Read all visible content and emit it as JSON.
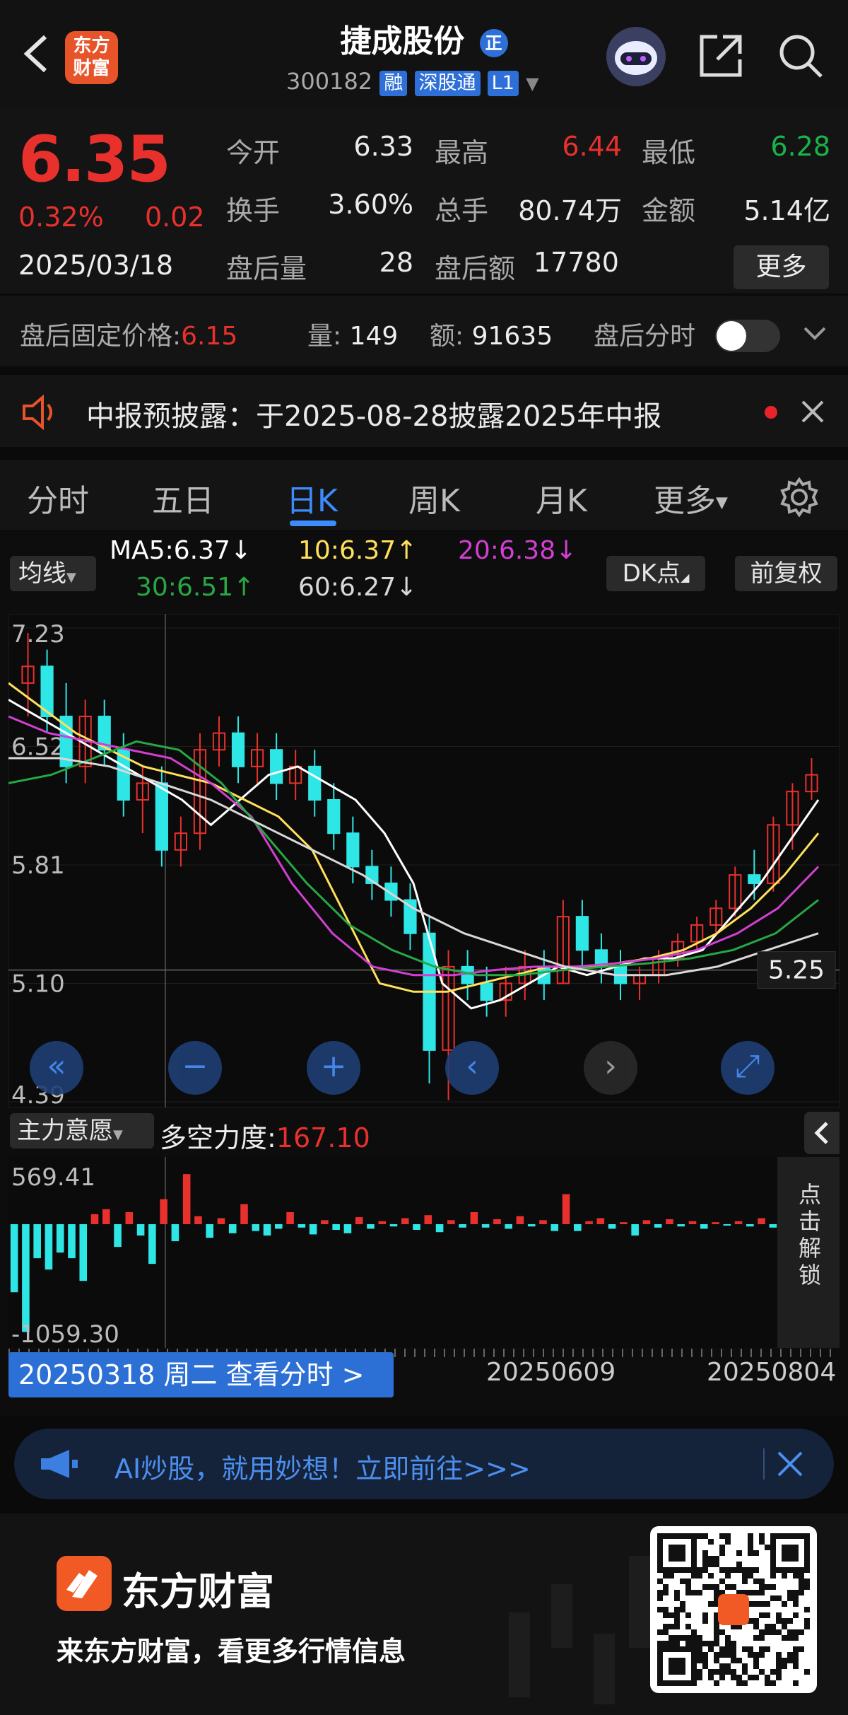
{
  "header": {
    "stock_name": "捷成股份",
    "badge": "正",
    "code": "300182",
    "tags": [
      "融",
      "深股通",
      "L1"
    ],
    "logo_line1": "东方",
    "logo_line2": "财富"
  },
  "quote": {
    "price": "6.35",
    "change_pct": "0.32%",
    "change": "0.02",
    "date": "2025/03/18",
    "open_label": "今开",
    "open": "6.33",
    "high_label": "最高",
    "high": "6.44",
    "low_label": "最低",
    "low": "6.28",
    "turnover_label": "换手",
    "turnover": "3.60%",
    "volume_label": "总手",
    "volume": "80.74万",
    "amount_label": "金额",
    "amount": "5.14亿",
    "after_vol_label": "盘后量",
    "after_vol": "28",
    "after_amt_label": "盘后额",
    "after_amt": "17780",
    "more": "更多"
  },
  "after_hours": {
    "fixed_label": "盘后固定价格:",
    "fixed_value": "6.15",
    "vol_label": "量:",
    "vol_value": "149",
    "amt_label": "额:",
    "amt_value": "91635",
    "timeshare_label": "盘后分时"
  },
  "notice": {
    "text": "中报预披露：于2025-08-28披露2025年中报"
  },
  "tabs": [
    "分时",
    "五日",
    "日K",
    "周K",
    "月K",
    "更多"
  ],
  "active_tab": "日K",
  "ma_bar": {
    "selector": "均线",
    "ma5": "MA5:6.37↓",
    "ma10": "10:6.37↑",
    "ma20": "20:6.38↓",
    "ma30": "30:6.51↑",
    "ma60": "60:6.27↓",
    "dk": "DK点",
    "adjust": "前复权"
  },
  "chart_data": {
    "type": "candlestick",
    "y_ticks": [
      "7.23",
      "6.52",
      "5.81",
      "5.10",
      "4.39"
    ],
    "ylim": [
      4.39,
      7.23
    ],
    "last_price_label": "5.25",
    "x_labels": [
      "20250318 周二 查看分时 >",
      "20250609",
      "20250804"
    ],
    "candles": [
      [
        6.9,
        7.2,
        6.7,
        7.0
      ],
      [
        7.0,
        7.1,
        6.6,
        6.7
      ],
      [
        6.7,
        6.9,
        6.3,
        6.4
      ],
      [
        6.4,
        6.8,
        6.3,
        6.7
      ],
      [
        6.7,
        6.8,
        6.4,
        6.5
      ],
      [
        6.5,
        6.6,
        6.1,
        6.2
      ],
      [
        6.2,
        6.4,
        6.0,
        6.3
      ],
      [
        6.3,
        6.4,
        5.8,
        5.9
      ],
      [
        5.9,
        6.1,
        5.8,
        6.0
      ],
      [
        6.0,
        6.6,
        5.9,
        6.5
      ],
      [
        6.5,
        6.7,
        6.4,
        6.6
      ],
      [
        6.6,
        6.7,
        6.3,
        6.4
      ],
      [
        6.4,
        6.6,
        6.3,
        6.5
      ],
      [
        6.5,
        6.6,
        6.2,
        6.3
      ],
      [
        6.3,
        6.5,
        6.2,
        6.4
      ],
      [
        6.4,
        6.5,
        6.1,
        6.2
      ],
      [
        6.2,
        6.3,
        5.9,
        6.0
      ],
      [
        6.0,
        6.1,
        5.7,
        5.8
      ],
      [
        5.8,
        5.9,
        5.6,
        5.7
      ],
      [
        5.7,
        5.8,
        5.5,
        5.6
      ],
      [
        5.6,
        5.7,
        5.3,
        5.4
      ],
      [
        5.4,
        5.5,
        4.5,
        4.7
      ],
      [
        4.7,
        5.3,
        4.4,
        5.2
      ],
      [
        5.2,
        5.3,
        5.0,
        5.1
      ],
      [
        5.1,
        5.2,
        4.9,
        5.0
      ],
      [
        5.0,
        5.2,
        4.9,
        5.1
      ],
      [
        5.1,
        5.3,
        5.0,
        5.2
      ],
      [
        5.2,
        5.3,
        5.0,
        5.1
      ],
      [
        5.1,
        5.6,
        5.1,
        5.5
      ],
      [
        5.5,
        5.6,
        5.2,
        5.3
      ],
      [
        5.3,
        5.4,
        5.1,
        5.2
      ],
      [
        5.2,
        5.3,
        5.0,
        5.1
      ],
      [
        5.1,
        5.2,
        5.0,
        5.15
      ],
      [
        5.15,
        5.3,
        5.1,
        5.25
      ],
      [
        5.25,
        5.4,
        5.2,
        5.35
      ],
      [
        5.35,
        5.5,
        5.3,
        5.45
      ],
      [
        5.45,
        5.6,
        5.4,
        5.55
      ],
      [
        5.55,
        5.8,
        5.5,
        5.75
      ],
      [
        5.75,
        5.9,
        5.6,
        5.7
      ],
      [
        5.7,
        6.1,
        5.65,
        6.05
      ],
      [
        6.05,
        6.3,
        5.9,
        6.25
      ],
      [
        6.25,
        6.45,
        6.2,
        6.35
      ]
    ],
    "ma_series": [
      {
        "name": "MA5",
        "color": "#ffffff",
        "values": [
          6.8,
          6.7,
          6.6,
          6.5,
          6.4,
          6.3,
          6.2,
          6.05,
          6.2,
          6.35,
          6.4,
          6.3,
          6.2,
          6.0,
          5.7,
          5.1,
          4.95,
          5.0,
          5.1,
          5.2,
          5.15,
          5.2,
          5.25,
          5.25,
          5.3,
          5.5,
          5.7,
          5.95,
          6.2
        ]
      },
      {
        "name": "MA10",
        "color": "#ffe05a",
        "values": [
          6.9,
          6.75,
          6.6,
          6.5,
          6.4,
          6.35,
          6.3,
          6.2,
          6.1,
          5.9,
          5.5,
          5.1,
          5.05,
          5.05,
          5.1,
          5.15,
          5.2,
          5.2,
          5.22,
          5.25,
          5.3,
          5.4,
          5.55,
          5.75,
          6.0
        ]
      },
      {
        "name": "MA20",
        "color": "#d23fd2",
        "values": [
          6.7,
          6.6,
          6.55,
          6.5,
          6.45,
          6.3,
          6.1,
          5.7,
          5.4,
          5.2,
          5.15,
          5.15,
          5.18,
          5.2,
          5.2,
          5.22,
          5.25,
          5.3,
          5.4,
          5.55,
          5.8
        ]
      },
      {
        "name": "MA30",
        "color": "#28a745",
        "values": [
          6.3,
          6.35,
          6.45,
          6.55,
          6.5,
          6.3,
          6.0,
          5.7,
          5.45,
          5.3,
          5.2,
          5.15,
          5.15,
          5.18,
          5.2,
          5.22,
          5.25,
          5.3,
          5.4,
          5.6
        ]
      },
      {
        "name": "MA60",
        "color": "#d8d8d8",
        "values": [
          6.45,
          6.45,
          6.4,
          6.3,
          6.2,
          6.05,
          5.9,
          5.75,
          5.55,
          5.4,
          5.3,
          5.2,
          5.15,
          5.15,
          5.2,
          5.3,
          5.4
        ]
      }
    ],
    "indicator": {
      "selector": "主力意愿",
      "name_label": "多空力度:",
      "value": "167.10",
      "y_top": "569.41",
      "y_bottom": "-1059.30",
      "unlock": "点击解锁",
      "bars": [
        -600,
        -950,
        -300,
        -400,
        -250,
        -300,
        -500,
        100,
        150,
        -200,
        120,
        -100,
        -350,
        250,
        -150,
        500,
        80,
        -120,
        60,
        -80,
        200,
        -60,
        -100,
        -40,
        120,
        -30,
        -90,
        40,
        -50,
        -80,
        70,
        -40,
        30,
        -20,
        60,
        -50,
        90,
        -70,
        40,
        -30,
        120,
        -30,
        50,
        -40,
        80,
        -20,
        40,
        -60,
        300,
        -60,
        30,
        60,
        -40,
        20,
        -100,
        40,
        -30,
        50,
        -20,
        30,
        -40,
        20,
        -10,
        30,
        -20,
        60,
        -30
      ]
    }
  },
  "nav_buttons": [
    "«",
    "−",
    "+",
    "‹",
    "›",
    "⤢"
  ],
  "ai_bar": {
    "text": "AI炒股，就用妙想！立即前往>>>"
  },
  "footer": {
    "brand": "东方财富",
    "slogan": "来东方财富，看更多行情信息"
  }
}
